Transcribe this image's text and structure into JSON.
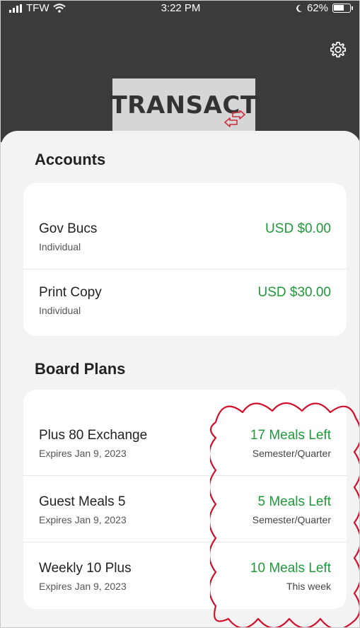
{
  "status_bar": {
    "carrier": "TFW",
    "time": "3:22 PM",
    "battery": "62%"
  },
  "header": {
    "logo_text": "TRANSACT",
    "settings_icon": "gear-icon"
  },
  "accounts": {
    "title": "Accounts",
    "items": [
      {
        "name": "Gov Bucs",
        "type": "Individual",
        "balance": "USD $0.00"
      },
      {
        "name": "Print Copy",
        "type": "Individual",
        "balance": "USD $30.00"
      }
    ]
  },
  "board_plans": {
    "title": "Board Plans",
    "items": [
      {
        "name": "Plus 80 Exchange",
        "expires": "Expires Jan 9, 2023",
        "meals": "17 Meals Left",
        "period": "Semester/Quarter"
      },
      {
        "name": "Guest Meals 5",
        "expires": "Expires Jan 9, 2023",
        "meals": "5 Meals Left",
        "period": "Semester/Quarter"
      },
      {
        "name": "Weekly 10 Plus",
        "expires": "Expires Jan 9, 2023",
        "meals": "10 Meals Left",
        "period": "This week"
      }
    ]
  },
  "colors": {
    "header_bg": "#3b3b3b",
    "green": "#1f9a3a",
    "annotation_red": "#d0102b"
  }
}
